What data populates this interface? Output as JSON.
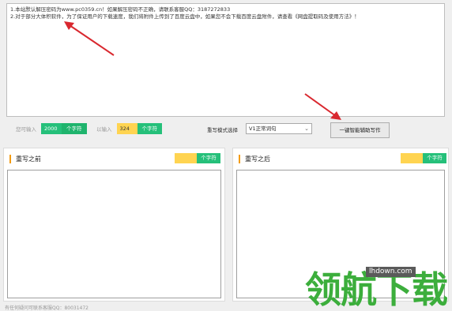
{
  "textarea": {
    "line1": "1.本站默认解压密码为www.pc0359.cn！如果解压密码不正确，请联系客服QQ：3187272833",
    "line2": "2.对于部分大体积软件，为了保证用户的下载速度，我们将附件上传到了百度云盘中，如果您不会下载百度云盘附件，请查看《网盘提取码及使用方法》！"
  },
  "counters": {
    "can_input_label": "您可输入",
    "can_input_value": "2000",
    "input_unit": "个字符",
    "entered_label": "以输入",
    "entered_value": "324",
    "entered_unit": "个字符"
  },
  "mode": {
    "label": "重写模式选择",
    "selected": "V1正常词句"
  },
  "rewrite_button": "一键智能辅助写作",
  "panel_before": {
    "title": "重写之前",
    "unit": "个字符"
  },
  "panel_after": {
    "title": "重写之后",
    "unit": "个字符"
  },
  "footer": "有任何疑问可联系客服QQ：80031472",
  "watermark": {
    "url": "lhdown.com",
    "text": "领航下载"
  },
  "colors": {
    "green": "#25c07a",
    "yellow": "#ffd451",
    "orange_accent": "#f39c12",
    "arrow_red": "#d9282f"
  }
}
